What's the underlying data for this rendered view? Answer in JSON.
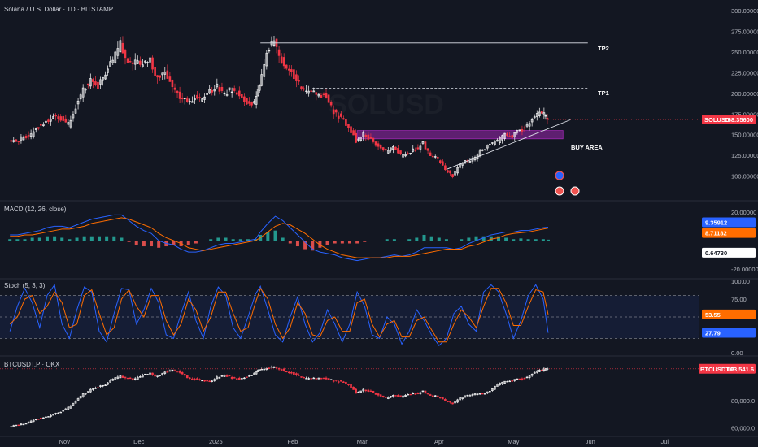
{
  "colors": {
    "background": "#131722",
    "separator": "#2a2e39",
    "up": "#ffffff",
    "down": "#f23645",
    "macd_line": "#2962ff",
    "signal_line": "#ff6d00",
    "hist_pos": "#26a69a",
    "hist_neg": "#ef5350",
    "stoch_k": "#2962ff",
    "stoch_d": "#ff6d00",
    "buy_area": "#9c27b0",
    "price_tag": "#f23645"
  },
  "chart_data": [
    {
      "type": "candlestick",
      "title": "Solana / U.S. Dollar · 1D · BITSTAMP",
      "watermark": "SOLUSD",
      "ylim": [
        75,
        305
      ],
      "yticks": [
        100,
        125,
        150,
        175,
        200,
        225,
        250,
        275,
        300
      ],
      "ytick_labels": [
        "100.00000",
        "125.00000",
        "150.00000",
        "175.00000",
        "200.00000",
        "225.00000",
        "250.00000",
        "275.00000",
        "300.00000"
      ],
      "x": [
        "2024-10-10",
        "2024-10-13",
        "2024-10-16",
        "2024-10-19",
        "2024-10-22",
        "2024-10-25",
        "2024-10-28",
        "2024-10-31",
        "2024-11-03",
        "2024-11-06",
        "2024-11-09",
        "2024-11-12",
        "2024-11-15",
        "2024-11-18",
        "2024-11-21",
        "2024-11-24",
        "2024-11-27",
        "2024-11-30",
        "2024-12-03",
        "2024-12-06",
        "2024-12-09",
        "2024-12-12",
        "2024-12-15",
        "2024-12-18",
        "2024-12-21",
        "2024-12-24",
        "2024-12-27",
        "2024-12-30",
        "2025-01-02",
        "2025-01-05",
        "2025-01-08",
        "2025-01-11",
        "2025-01-14",
        "2025-01-17",
        "2025-01-19",
        "2025-01-22",
        "2025-01-25",
        "2025-01-28",
        "2025-01-31",
        "2025-02-03",
        "2025-02-06",
        "2025-02-09",
        "2025-02-12",
        "2025-02-15",
        "2025-02-18",
        "2025-02-21",
        "2025-02-24",
        "2025-02-27",
        "2025-03-02",
        "2025-03-05",
        "2025-03-08",
        "2025-03-11",
        "2025-03-14",
        "2025-03-17",
        "2025-03-20",
        "2025-03-23",
        "2025-03-26",
        "2025-03-29",
        "2025-04-01",
        "2025-04-04",
        "2025-04-07",
        "2025-04-10",
        "2025-04-13",
        "2025-04-16",
        "2025-04-19",
        "2025-04-22",
        "2025-04-25",
        "2025-04-28",
        "2025-05-01",
        "2025-05-04",
        "2025-05-07",
        "2025-05-10",
        "2025-05-13",
        "2025-05-15"
      ],
      "close": [
        145,
        141,
        148,
        150,
        160,
        165,
        172,
        170,
        162,
        184,
        205,
        215,
        208,
        225,
        240,
        260,
        240,
        238,
        235,
        240,
        218,
        225,
        210,
        195,
        190,
        195,
        193,
        202,
        208,
        200,
        205,
        198,
        190,
        188,
        210,
        250,
        265,
        240,
        230,
        215,
        205,
        200,
        200,
        195,
        178,
        170,
        160,
        143,
        150,
        145,
        135,
        130,
        135,
        125,
        128,
        132,
        140,
        125,
        120,
        108,
        100,
        115,
        118,
        122,
        132,
        138,
        142,
        150,
        148,
        155,
        160,
        172,
        178,
        168
      ],
      "xticks": [
        {
          "label": "Nov",
          "date": "2024-11-01"
        },
        {
          "label": "Dec",
          "date": "2024-12-01"
        },
        {
          "label": "2025",
          "date": "2025-01-01"
        },
        {
          "label": "Feb",
          "date": "2025-02-01"
        },
        {
          "label": "Mar",
          "date": "2025-03-01"
        },
        {
          "label": "Apr",
          "date": "2025-04-01"
        },
        {
          "label": "May",
          "date": "2025-05-01"
        },
        {
          "label": "Jun",
          "date": "2025-06-01"
        },
        {
          "label": "Jul",
          "date": "2025-07-01"
        }
      ],
      "annotations": {
        "tp2": {
          "label": "TP2",
          "value": 261,
          "from": "2025-01-19",
          "to": "2025-05-31"
        },
        "tp1": {
          "label": "TP1",
          "value": 206,
          "from": "2025-02-09",
          "to": "2025-05-31"
        },
        "buy_area": {
          "label": "BUY AREA",
          "low": 145,
          "high": 155,
          "from": "2025-02-27",
          "to": "2025-05-21"
        },
        "trendline": {
          "from": {
            "date": "2025-04-04",
            "value": 108
          },
          "to": {
            "date": "2025-05-24",
            "value": 168
          }
        }
      },
      "last_price_tag": {
        "symbol": "SOLUSD",
        "value": "168.35600",
        "y": 168.356
      }
    },
    {
      "type": "line",
      "title": "MACD (12, 26, close)",
      "ylim": [
        -25,
        25
      ],
      "yticks": [
        20,
        -20
      ],
      "ytick_labels": [
        "20.00000",
        "-20.00000"
      ],
      "series": [
        {
          "name": "MACD",
          "values": [
            4,
            4,
            5,
            6,
            7,
            9,
            10,
            10,
            9,
            11,
            13,
            15,
            16,
            17,
            18,
            18,
            14,
            10,
            7,
            5,
            0,
            -2,
            -3,
            -6,
            -8,
            -8,
            -7,
            -5,
            -3,
            -2,
            -2,
            -1,
            0,
            1,
            6,
            12,
            17,
            14,
            9,
            4,
            -1,
            -6,
            -8,
            -9,
            -10,
            -12,
            -13,
            -14,
            -13,
            -12,
            -12,
            -11,
            -10,
            -11,
            -10,
            -8,
            -5,
            -5,
            -5,
            -5,
            -6,
            -5,
            -2,
            0,
            2,
            4,
            5,
            6,
            6,
            7,
            7,
            8,
            9,
            9.35912
          ]
        },
        {
          "name": "Signal",
          "values": [
            3,
            3,
            4,
            4,
            5,
            6,
            7,
            8,
            8,
            9,
            10,
            12,
            13,
            14,
            15,
            16,
            15,
            13,
            11,
            9,
            5,
            2,
            0,
            -2,
            -5,
            -6,
            -7,
            -6,
            -5,
            -4,
            -3,
            -2,
            -1,
            0,
            2,
            6,
            10,
            12,
            11,
            8,
            5,
            1,
            -3,
            -6,
            -8,
            -10,
            -11,
            -12,
            -12,
            -12,
            -12,
            -12,
            -11,
            -11,
            -11,
            -10,
            -9,
            -8,
            -7,
            -6,
            -6,
            -6,
            -4,
            -3,
            -1,
            1,
            2,
            4,
            5,
            5.5,
            6,
            7,
            8,
            8.71182
          ]
        }
      ],
      "histogram": [
        0.6473
      ],
      "value_tags": [
        {
          "value": "9.35912",
          "y": 9.35912,
          "color": "#2962ff"
        },
        {
          "value": "8.71182",
          "y": 8.71182,
          "color": "#ff6d00"
        },
        {
          "value": "0.64730",
          "y": 0.6473,
          "color": "#ffffff"
        }
      ]
    },
    {
      "type": "line",
      "title": "Stoch (5, 3, 3)",
      "ylim": [
        0,
        100
      ],
      "yticks": [
        100,
        75,
        50,
        25,
        0
      ],
      "ytick_labels": [
        "100.00",
        "75.00",
        "50.00",
        "25.00",
        "0.00"
      ],
      "bands": [
        20,
        50,
        80
      ],
      "series": [
        {
          "name": "%K",
          "values": [
            30,
            65,
            90,
            70,
            35,
            80,
            95,
            40,
            20,
            60,
            92,
            85,
            30,
            15,
            55,
            90,
            88,
            40,
            60,
            90,
            70,
            25,
            20,
            55,
            85,
            45,
            20,
            65,
            92,
            80,
            35,
            20,
            50,
            82,
            93,
            60,
            25,
            15,
            50,
            78,
            40,
            15,
            28,
            60,
            40,
            15,
            40,
            85,
            65,
            25,
            20,
            50,
            40,
            12,
            30,
            60,
            45,
            25,
            10,
            20,
            55,
            65,
            40,
            30,
            85,
            95,
            85,
            55,
            20,
            45,
            80,
            95,
            75,
            27.79
          ]
        },
        {
          "name": "%D",
          "values": [
            40,
            50,
            75,
            80,
            55,
            65,
            85,
            70,
            35,
            40,
            80,
            88,
            55,
            25,
            35,
            75,
            88,
            65,
            50,
            80,
            80,
            45,
            25,
            40,
            75,
            60,
            30,
            50,
            85,
            85,
            55,
            30,
            35,
            70,
            90,
            75,
            40,
            20,
            35,
            70,
            55,
            25,
            22,
            45,
            50,
            30,
            30,
            70,
            75,
            40,
            22,
            40,
            45,
            22,
            22,
            45,
            50,
            32,
            15,
            15,
            40,
            60,
            50,
            35,
            65,
            90,
            90,
            70,
            38,
            38,
            65,
            88,
            85,
            53.55
          ]
        }
      ],
      "value_tags": [
        {
          "value": "53.55",
          "y": 53.55,
          "color": "#ff6d00"
        },
        {
          "value": "27.79",
          "y": 27.79,
          "color": "#2962ff"
        }
      ]
    },
    {
      "type": "candlestick",
      "title": "BTCUSDT.P · OKX",
      "ylim": [
        55000,
        110000
      ],
      "yticks": [
        80000,
        60000
      ],
      "ytick_labels": [
        "80,000.0",
        "60,000.0"
      ],
      "close": [
        61000,
        62000,
        63000,
        65000,
        67000,
        68000,
        70000,
        72000,
        75000,
        80000,
        85000,
        88000,
        90000,
        92000,
        96000,
        98000,
        97000,
        96000,
        99000,
        100000,
        98000,
        101000,
        103000,
        101000,
        97000,
        96000,
        95000,
        94000,
        97000,
        99000,
        97000,
        96000,
        98000,
        100000,
        103000,
        104000,
        105000,
        103000,
        101000,
        99000,
        97000,
        96000,
        97000,
        96000,
        95000,
        94000,
        92000,
        86000,
        88000,
        87000,
        84000,
        82000,
        84000,
        83000,
        85000,
        85000,
        87000,
        84000,
        83000,
        80000,
        78000,
        82000,
        84000,
        85000,
        85000,
        87000,
        92000,
        94000,
        95000,
        96000,
        97000,
        101000,
        103000,
        103541.6
      ],
      "last_price_tag": {
        "symbol": "BTCUSDT.P",
        "value": "103,541.6",
        "y": 103541.6
      }
    }
  ]
}
